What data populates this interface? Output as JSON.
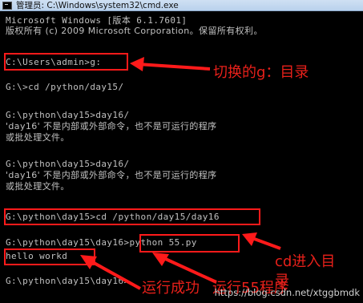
{
  "window": {
    "title": "管理员: C:\\Windows\\system32\\cmd.exe",
    "icon": "console-icon"
  },
  "console": {
    "lines": [
      "Microsoft Windows [版本 6.1.7601]",
      "版权所有 (c) 2009 Microsoft Corporation。保留所有权利。",
      "",
      "C:\\Users\\admin>g:",
      "",
      "G:\\>cd /python/day15/",
      "",
      "G:\\python\\day15>day16/",
      "'day16' 不是内部或外部命令，也不是可运行的程序",
      "或批处理文件。",
      "",
      "G:\\python\\day15>day16/",
      "'day16' 不是内部或外部命令，也不是可运行的程序",
      "或批处理文件。",
      "",
      "G:\\python\\day15>cd /python/day15/day16",
      "",
      "G:\\python\\day15\\day16>python 55.py",
      "hello workd",
      "",
      "G:\\python\\day15\\day16>"
    ]
  },
  "annotations": {
    "switch_dir": "切换的g：目录",
    "cd_dir_line1": "cd进入目",
    "cd_dir_line2": "录",
    "run_success": "运行成功",
    "run_55": "运行55程序"
  },
  "watermark": "https://blog.csdn.net/xtggbmdk",
  "colors": {
    "background": "#000000",
    "text": "#c0c0c0",
    "annotation": "#e8201a"
  }
}
